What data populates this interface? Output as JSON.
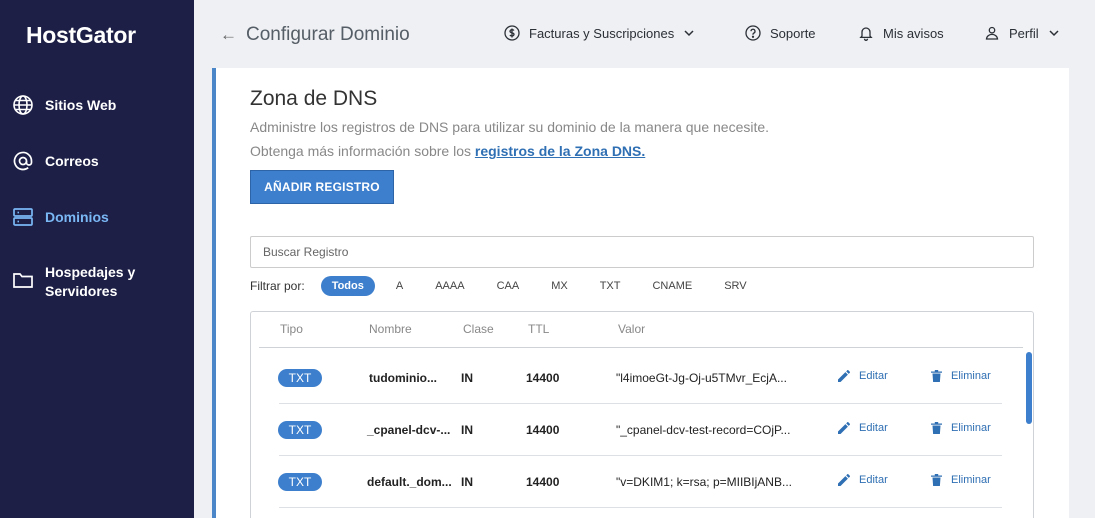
{
  "sidebar": {
    "logo": "HostGator",
    "items": [
      {
        "label": "Sitios Web",
        "icon": "globe-icon"
      },
      {
        "label": "Correos",
        "icon": "at-icon"
      },
      {
        "label": "Dominios",
        "icon": "server-icon"
      },
      {
        "label": "Hospedajes y Servidores",
        "icon": "folder-icon"
      }
    ],
    "active_index": 2
  },
  "header": {
    "title": "Configurar Dominio",
    "invoices": "Facturas y Suscripciones",
    "support": "Soporte",
    "notices": "Mis avisos",
    "profile": "Perfil"
  },
  "dns": {
    "title": "Zona de DNS",
    "description": "Administre los registros de DNS para utilizar su dominio de la manera que necesite.",
    "info_prefix": "Obtenga más información sobre los ",
    "info_link": "registros de la Zona DNS.",
    "add_button": "AÑADIR REGISTRO",
    "search_placeholder": "Buscar Registro",
    "filter_label": "Filtrar por:",
    "filters": [
      "Todos",
      "A",
      "AAAA",
      "CAA",
      "MX",
      "TXT",
      "CNAME",
      "SRV"
    ],
    "active_filter": "Todos",
    "columns": [
      "Tipo",
      "Nombre",
      "Clase",
      "TTL",
      "Valor"
    ],
    "edit_label": "Editar",
    "delete_label": "Eliminar",
    "rows": [
      {
        "type": "TXT",
        "name": "tudominio...",
        "class": "IN",
        "ttl": "14400",
        "value": "\"l4imoeGt-Jg-Oj-u5TMvr_EcjA..."
      },
      {
        "type": "TXT",
        "name": "_cpanel-dcv-...",
        "class": "IN",
        "ttl": "14400",
        "value": "\"_cpanel-dcv-test-record=COjP..."
      },
      {
        "type": "TXT",
        "name": "default._dom...",
        "class": "IN",
        "ttl": "14400",
        "value": "\"v=DKIM1; k=rsa; p=MIIBIjANB..."
      }
    ]
  },
  "colors": {
    "sidebar_bg": "#1d1f46",
    "accent": "#3d7fcc",
    "active_nav": "#7ab8f5"
  }
}
